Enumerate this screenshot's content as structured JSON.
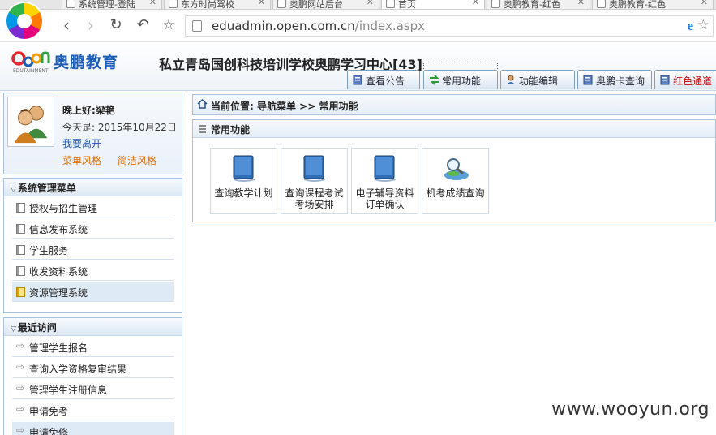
{
  "browser": {
    "tabs": [
      {
        "label": "系统管理-登陆"
      },
      {
        "label": "东方时尚驾校"
      },
      {
        "label": "奥鹏网站后台"
      },
      {
        "label": "首页"
      },
      {
        "label": "奥鹏教育-红色"
      },
      {
        "label": "奥鹏教育-红色"
      }
    ],
    "url_host": "eduadmin.open.com.cn",
    "url_path": "/index.aspx"
  },
  "header": {
    "brand_name": "奥鹏教育",
    "brand_sub": "EDUTAINMENT",
    "school_title": "私立青岛国创科技培训学校奥鹏学习中心[43]",
    "tabs": [
      {
        "label": "查看公告"
      },
      {
        "label": "常用功能"
      },
      {
        "label": "功能编辑"
      },
      {
        "label": "奥鹏卡查询"
      },
      {
        "label": "红色通道"
      }
    ]
  },
  "user": {
    "greeting": "晚上好:梁艳",
    "today": "今天是: 2015年10月22日",
    "logout": "我要离开",
    "style_menu": "菜单风格",
    "style_simple": "简洁风格"
  },
  "system_menu": {
    "title": "系统管理菜单",
    "items": [
      {
        "label": "授权与招生管理"
      },
      {
        "label": "信息发布系统"
      },
      {
        "label": "学生服务"
      },
      {
        "label": "收发资料系统"
      },
      {
        "label": "资源管理系统"
      }
    ]
  },
  "recent": {
    "title": "最近访问",
    "items": [
      {
        "label": "管理学生报名"
      },
      {
        "label": "查询入学资格复审结果"
      },
      {
        "label": "管理学生注册信息"
      },
      {
        "label": "申请免考"
      },
      {
        "label": "申请免修"
      }
    ]
  },
  "breadcrumb": "当前位置: 导航菜单 >> 常用功能",
  "common": {
    "title": "常用功能",
    "tiles": [
      {
        "label": "查询教学计划"
      },
      {
        "label": "查询课程考试考场安排"
      },
      {
        "label": "电子辅导资料订单确认"
      },
      {
        "label": "机考成绩查询"
      }
    ]
  },
  "watermark": "www.wooyun.org",
  "colors": {
    "brand_blue": "#1b5cb8",
    "link_orange": "#e06a00",
    "panel_border": "#a9c1da",
    "red_channel": "#cc0000"
  }
}
